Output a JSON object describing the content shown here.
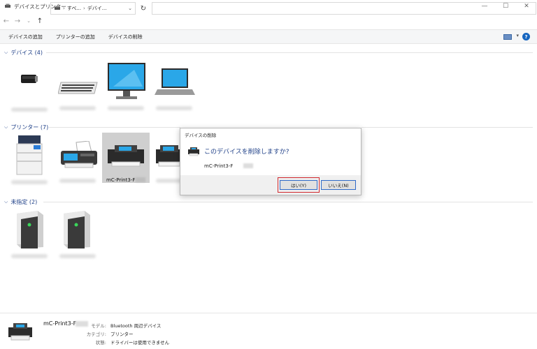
{
  "window": {
    "title": "デバイスとプリンター"
  },
  "address": {
    "parts": [
      "すべ...",
      "デバイ..."
    ]
  },
  "commands": [
    "デバイスの追加",
    "プリンターの追加",
    "デバイスの削除"
  ],
  "groups": {
    "devices": "デバイス (4)",
    "printers": "プリンター (7)",
    "unspecified": "未指定 (2)"
  },
  "selected_printer": {
    "label": "mC-Print3-F"
  },
  "dialog": {
    "title": "デバイスの削除",
    "question": "このデバイスを削除しますか?",
    "device": "mC-Print3-F",
    "yes_label": "はい(Y)",
    "no_label": "いいえ(N)"
  },
  "details": {
    "name": "mC-Print3-F",
    "model_key": "モデル:",
    "model_value": "Bluetooth 周辺デバイス",
    "category_key": "カテゴリ:",
    "category_value": "プリンター",
    "status_key": "状態:",
    "status_value": "ドライバーは使用できません"
  },
  "colors": {
    "accent": "#1e3f87",
    "highlight": "#d0282e",
    "selected_bg": "#cfcfcf"
  }
}
